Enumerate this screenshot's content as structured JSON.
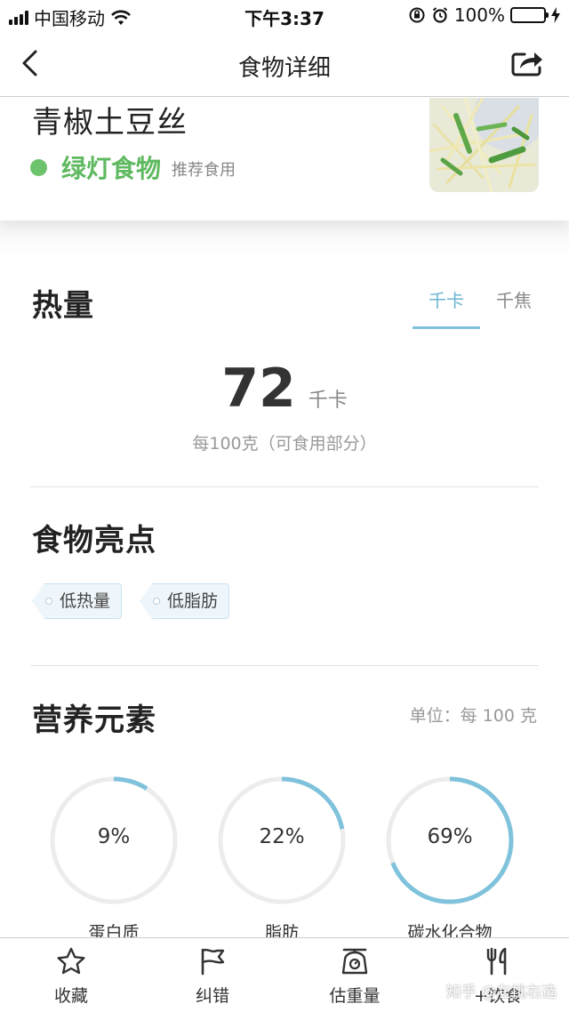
{
  "status_bar": {
    "carrier": "中国移动",
    "time": "下午3:37",
    "battery": "100%"
  },
  "nav": {
    "title": "食物详细",
    "back_icon": "chevron-left-icon",
    "share_icon": "share-icon"
  },
  "food": {
    "name": "青椒土豆丝",
    "light_label": "绿灯食物",
    "light_sub": "推荐食用",
    "light_color": "#6cc36b"
  },
  "energy": {
    "title": "热量",
    "units": [
      "千卡",
      "千焦"
    ],
    "active_unit": "千卡",
    "value": "72",
    "value_unit": "千卡",
    "per": "每100克（可食用部分）"
  },
  "highlights": {
    "title": "食物亮点",
    "tags": [
      "低热量",
      "低脂肪"
    ]
  },
  "nutrients": {
    "title": "营养元素",
    "unit_note": "单位：每 100 克",
    "accent": "#7fc2dc",
    "items": [
      {
        "label": "蛋白质",
        "pct_text": "9%",
        "pct": 9
      },
      {
        "label": "脂肪",
        "pct_text": "22%",
        "pct": 22
      },
      {
        "label": "碳水化合物",
        "pct_text": "69%",
        "pct": 69
      }
    ]
  },
  "tabbar": {
    "items": [
      {
        "label": "收藏",
        "icon": "star-icon"
      },
      {
        "label": "纠错",
        "icon": "flag-icon"
      },
      {
        "label": "估重量",
        "icon": "scale-icon"
      },
      {
        "label": "+饮食",
        "icon": "fork-knife-icon"
      }
    ]
  },
  "watermark": "知乎 @左挑右选"
}
